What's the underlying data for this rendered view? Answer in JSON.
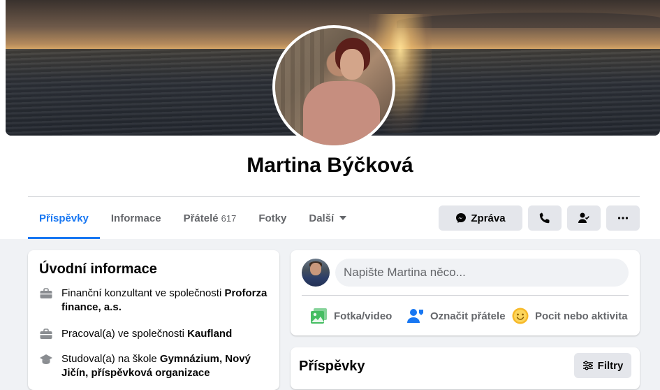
{
  "profile": {
    "name": "Martina Býčková"
  },
  "tabs": [
    {
      "label": "Příspěvky",
      "active": true
    },
    {
      "label": "Informace"
    },
    {
      "label": "Přátelé",
      "count": "617"
    },
    {
      "label": "Fotky"
    },
    {
      "label": "Další"
    }
  ],
  "actions": {
    "message_label": "Zpráva",
    "call_icon": "phone-icon",
    "friend_icon": "person-check-icon",
    "more_icon": "more-icon"
  },
  "intro": {
    "title": "Úvodní informace",
    "items": [
      {
        "icon": "briefcase-icon",
        "text": "Finanční konzultant ve společnosti ",
        "bold": "Proforza finance, a.s."
      },
      {
        "icon": "briefcase-icon",
        "text": "Pracoval(a) ve společnosti ",
        "bold": "Kaufland"
      },
      {
        "icon": "graduation-cap-icon",
        "text": "Studoval(a) na škole ",
        "bold": "Gymnázium, Nový Jičín, příspěvková organizace"
      }
    ]
  },
  "composer": {
    "placeholder": "Napište Martina něco...",
    "actions": [
      {
        "label": "Fotka/video",
        "icon": "photo-video-icon"
      },
      {
        "label": "Označit přátele",
        "icon": "tag-friends-icon"
      },
      {
        "label": "Pocit nebo aktivita",
        "icon": "feeling-icon"
      }
    ]
  },
  "posts": {
    "title": "Příspěvky",
    "filter_label": "Filtry"
  },
  "colors": {
    "accent": "#1877f2",
    "page_bg": "#f0f2f5",
    "button_bg": "#e4e6eb"
  }
}
